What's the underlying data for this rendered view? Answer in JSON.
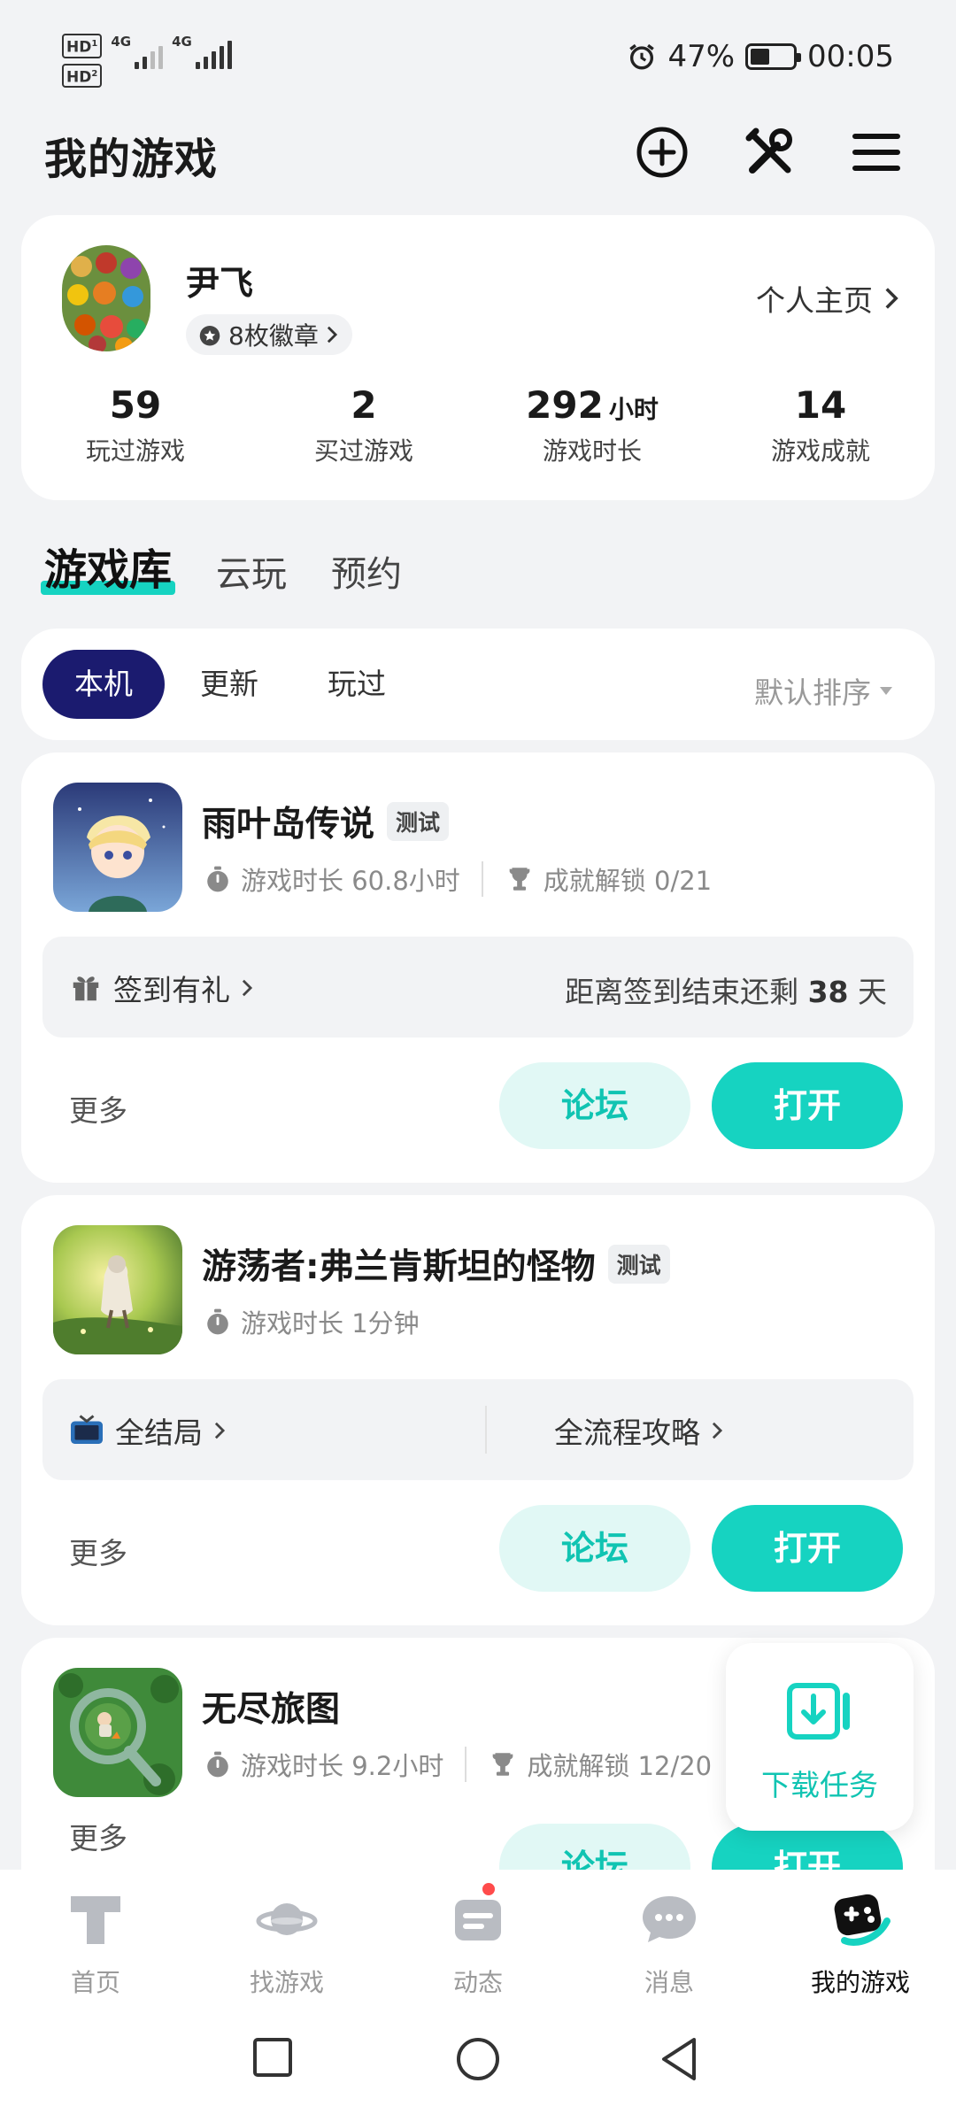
{
  "status_bar": {
    "hd1": "HD",
    "hd1_sub": "1",
    "hd2": "HD",
    "hd2_sub": "2",
    "net1": "4G",
    "net2": "4G",
    "battery_percent": "47%",
    "time": "00:05",
    "icons": [
      "alarm-icon",
      "battery-icon"
    ]
  },
  "header": {
    "title": "我的游戏",
    "icons": [
      "add-circle-icon",
      "tools-icon",
      "menu-icon"
    ]
  },
  "profile": {
    "username": "尹飞",
    "badges": "8枚徽章",
    "homepage_link": "个人主页",
    "stats": [
      {
        "value": "59",
        "unit": "",
        "label": "玩过游戏"
      },
      {
        "value": "2",
        "unit": "",
        "label": "买过游戏"
      },
      {
        "value": "292",
        "unit": "小时",
        "label": "游戏时长"
      },
      {
        "value": "14",
        "unit": "",
        "label": "游戏成就"
      }
    ]
  },
  "library_tabs": [
    {
      "label": "游戏库",
      "active": true
    },
    {
      "label": "云玩",
      "active": false
    },
    {
      "label": "预约",
      "active": false
    }
  ],
  "filters": {
    "pills": [
      {
        "label": "本机",
        "active": true
      },
      {
        "label": "更新",
        "active": false
      },
      {
        "label": "玩过",
        "active": false
      }
    ],
    "sort_label": "默认排序"
  },
  "games": [
    {
      "name": "雨叶岛传说",
      "tag": "测试",
      "playtime": "游戏时长 60.8小时",
      "achievements": "成就解锁 0/21",
      "strip_left": "签到有礼",
      "strip_right_prefix": "距离签到结束还剩",
      "strip_right_days": "38",
      "strip_right_suffix": "天",
      "more": "更多",
      "forum": "论坛",
      "open": "打开"
    },
    {
      "name": "游荡者:弗兰肯斯坦的怪物",
      "tag": "测试",
      "playtime": "游戏时长 1分钟",
      "strip_left": "全结局",
      "strip_mid": "全流程攻略",
      "more": "更多",
      "forum": "论坛",
      "open": "打开"
    },
    {
      "name": "无尽旅图",
      "playtime": "游戏时长 9.2小时",
      "achievements": "成就解锁 12/20",
      "more": "更多",
      "forum": "论坛",
      "open": "打开"
    }
  ],
  "floating": {
    "label": "下载任务"
  },
  "bottom_nav": [
    {
      "label": "首页",
      "active": false
    },
    {
      "label": "找游戏",
      "active": false
    },
    {
      "label": "动态",
      "active": false,
      "has_dot": true
    },
    {
      "label": "消息",
      "active": false
    },
    {
      "label": "我的游戏",
      "active": true
    }
  ],
  "colors": {
    "accent": "#16d3c1",
    "accent_light": "#e1f8f5",
    "navy": "#1b1b6f",
    "badge_dot": "#ff4b4b"
  }
}
